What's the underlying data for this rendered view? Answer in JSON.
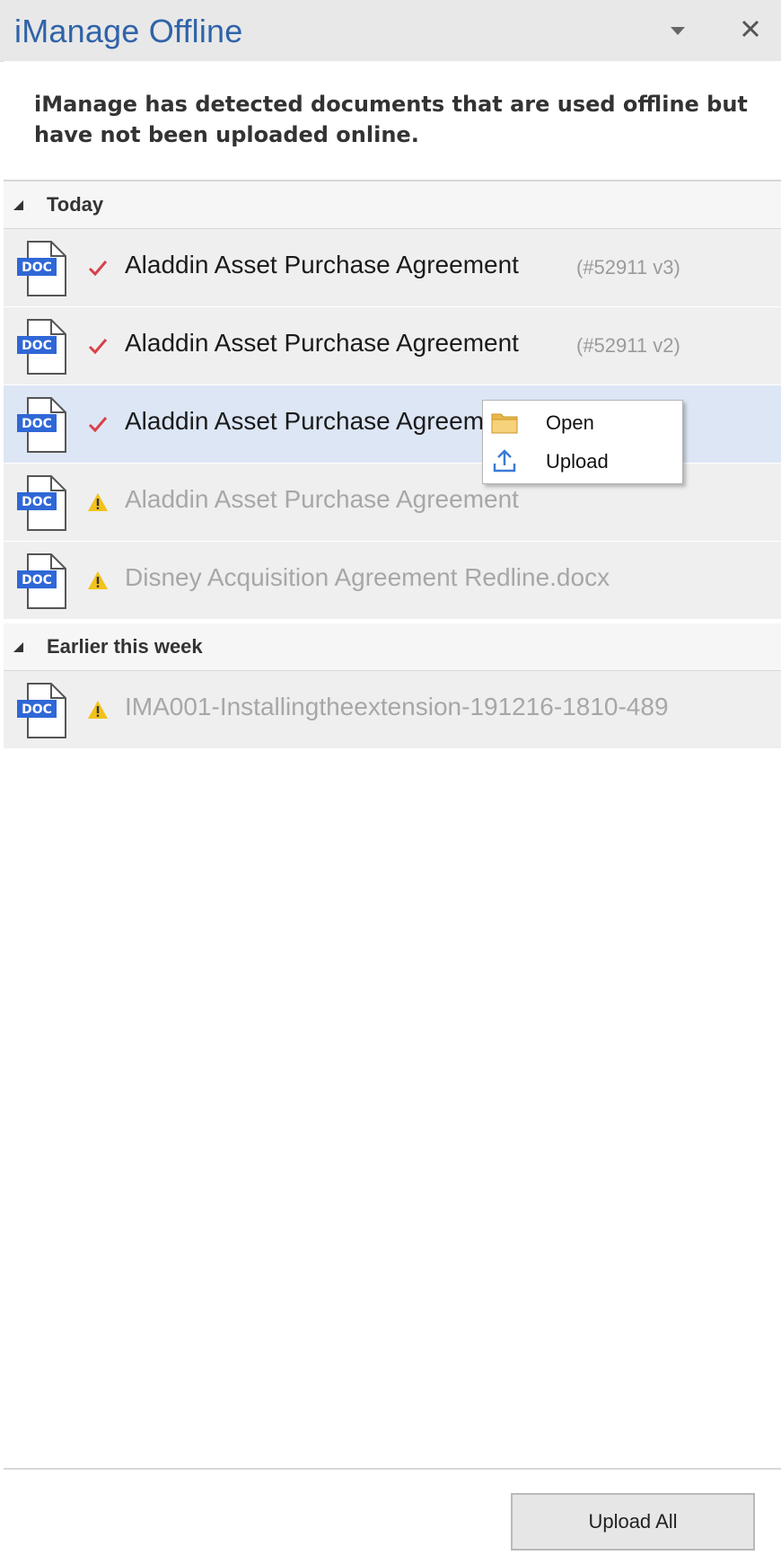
{
  "panel": {
    "title": "iManage Offline",
    "notice": "iManage has detected documents that are used offline but have not been uploaded online."
  },
  "groups": [
    {
      "label": "Today",
      "items": [
        {
          "name": "Aladdin Asset Purchase Agreement",
          "version": "(#52911 v3)",
          "status": "check",
          "doc_badge": "DOC"
        },
        {
          "name": "Aladdin Asset Purchase Agreement",
          "version": "(#52911 v2)",
          "status": "check",
          "doc_badge": "DOC"
        },
        {
          "name": "Aladdin Asset Purchase Agreement",
          "version": "",
          "status": "check",
          "doc_badge": "DOC",
          "selected": true
        },
        {
          "name": "Aladdin Asset Purchase Agreement",
          "version": "",
          "status": "warning",
          "doc_badge": "DOC"
        },
        {
          "name": "Disney Acquisition Agreement Redline.docx",
          "version": "",
          "status": "warning",
          "doc_badge": "DOC"
        }
      ]
    },
    {
      "label": "Earlier this week",
      "items": [
        {
          "name": "IMA001-Installingtheextension-191216-1810-489",
          "version": "",
          "status": "warning",
          "doc_badge": "DOC"
        }
      ]
    }
  ],
  "context_menu": {
    "items": [
      {
        "label": "Open",
        "icon": "folder-icon"
      },
      {
        "label": "Upload",
        "icon": "upload-icon"
      }
    ]
  },
  "footer": {
    "upload_all_label": "Upload All"
  },
  "colors": {
    "title": "#2f63a8",
    "check": "#d9404a",
    "warning": "#f2c21b",
    "doc_badge": "#2f67d6",
    "selected_row": "#dce6f5"
  }
}
